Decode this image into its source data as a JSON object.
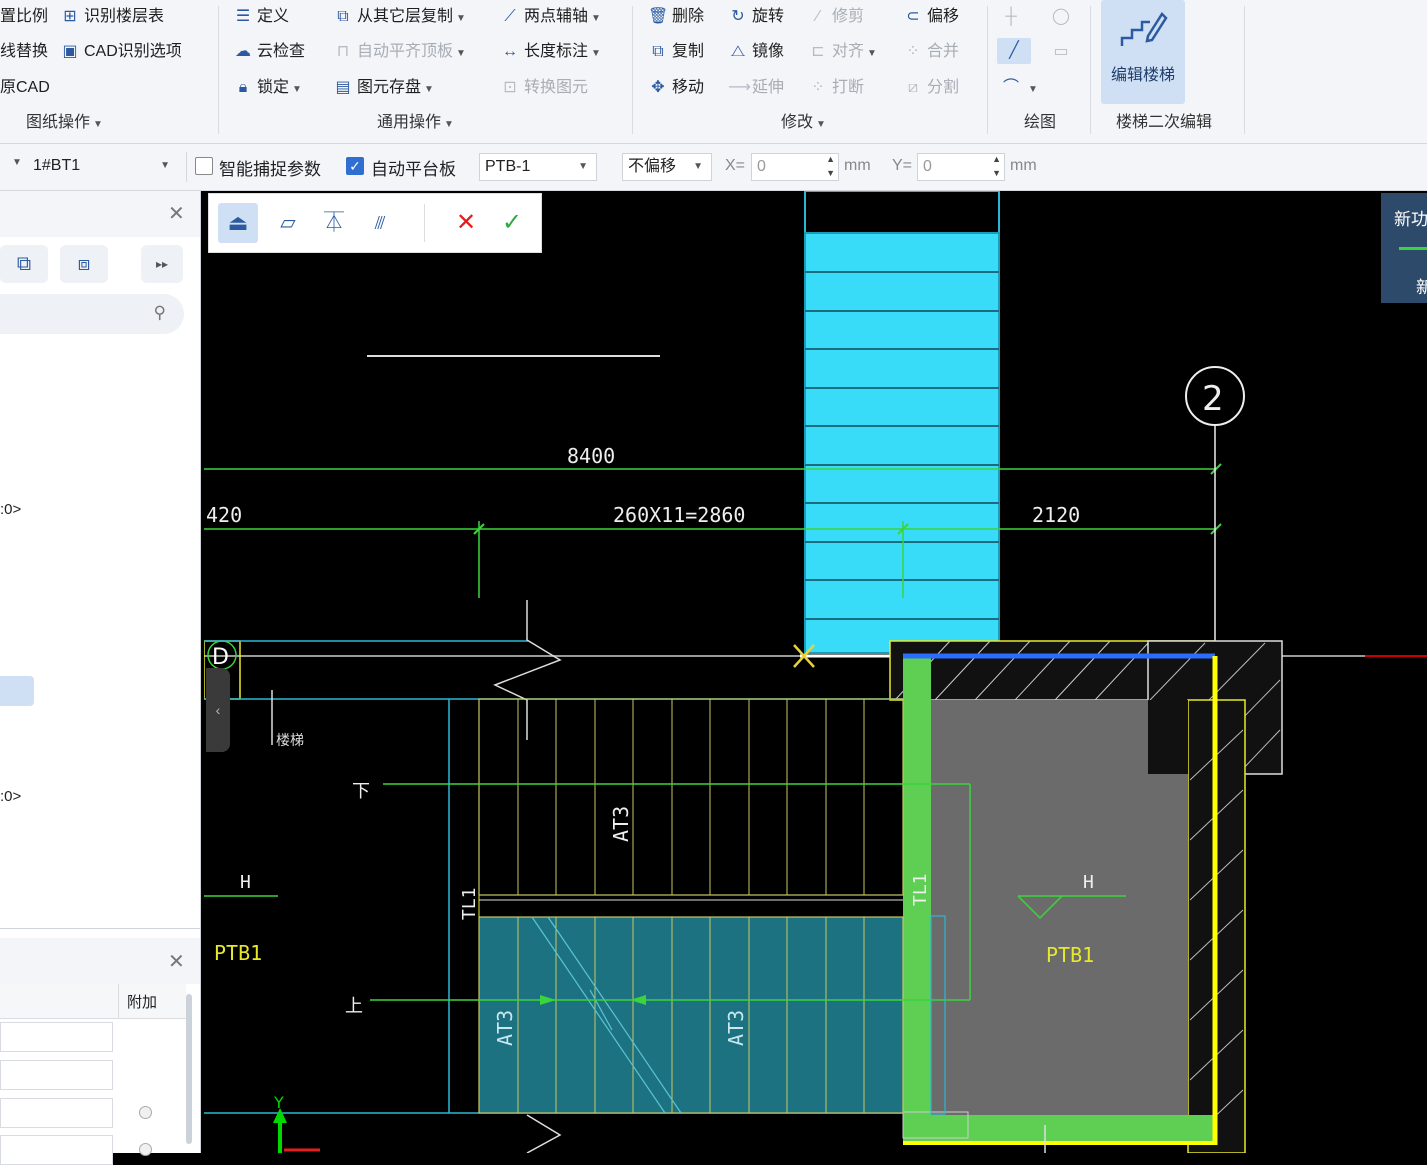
{
  "ribbon": {
    "paper_ops": {
      "items": [
        "置比例",
        "识别楼层表",
        "线替换",
        "CAD识别选项",
        "原CAD"
      ],
      "group_label": "图纸操作"
    },
    "general_ops": {
      "items": [
        "定义",
        "从其它层复制",
        "两点辅轴",
        "云检查",
        "自动平齐顶板",
        "长度标注",
        "锁定",
        "图元存盘",
        "转换图元"
      ],
      "group_label": "通用操作"
    },
    "modify": {
      "items": [
        "删除",
        "旋转",
        "修剪",
        "偏移",
        "复制",
        "镜像",
        "对齐",
        "合并",
        "移动",
        "延伸",
        "打断",
        "分割"
      ],
      "group_label": "修改"
    },
    "draw": {
      "group_label": "绘图"
    },
    "stair_edit": {
      "button_label": "编辑楼梯",
      "group_label": "楼梯二次编辑"
    }
  },
  "toolbar": {
    "component_select": "1#BT1",
    "smart_snap_label": "智能捕捉参数",
    "smart_snap_checked": false,
    "auto_platform_label": "自动平台板",
    "auto_platform_checked": true,
    "platform_select": "PTB-1",
    "offset_select": "不偏移",
    "x_label": "X=",
    "x_value": "0",
    "y_label": "Y=",
    "y_value": "0",
    "unit": "mm"
  },
  "left_panel": {
    "tree_item_1": ":0>",
    "tree_item_2": ":0>",
    "props_header": "附加"
  },
  "canvas": {
    "dims": {
      "total": "8400",
      "left": "420",
      "mid": "260X11=2860",
      "right": "2120"
    },
    "axis_label": "2",
    "grid_label": "D",
    "labels": {
      "at3_top": "AT3",
      "at3_bottom_left": "AT3",
      "at3_bottom_right": "AT3",
      "tl1_left": "TL1",
      "tl1_right": "TL1",
      "ptb1_left": "PTB1",
      "ptb1_right": "PTB1",
      "h_left": "H",
      "h_right": "H",
      "down": "下",
      "up": "上",
      "y_axis": "Y",
      "small_text": "楼梯"
    }
  },
  "new_feature": {
    "title": "新功",
    "sub": "新"
  },
  "colors": {
    "accent": "#2c5aa0",
    "stair_fill": "#39dcf8",
    "selected_green": "#5fcf53",
    "platform_gray": "#6b6b6b",
    "dim_green": "#3bd43b",
    "yellow": "#ffff00"
  }
}
